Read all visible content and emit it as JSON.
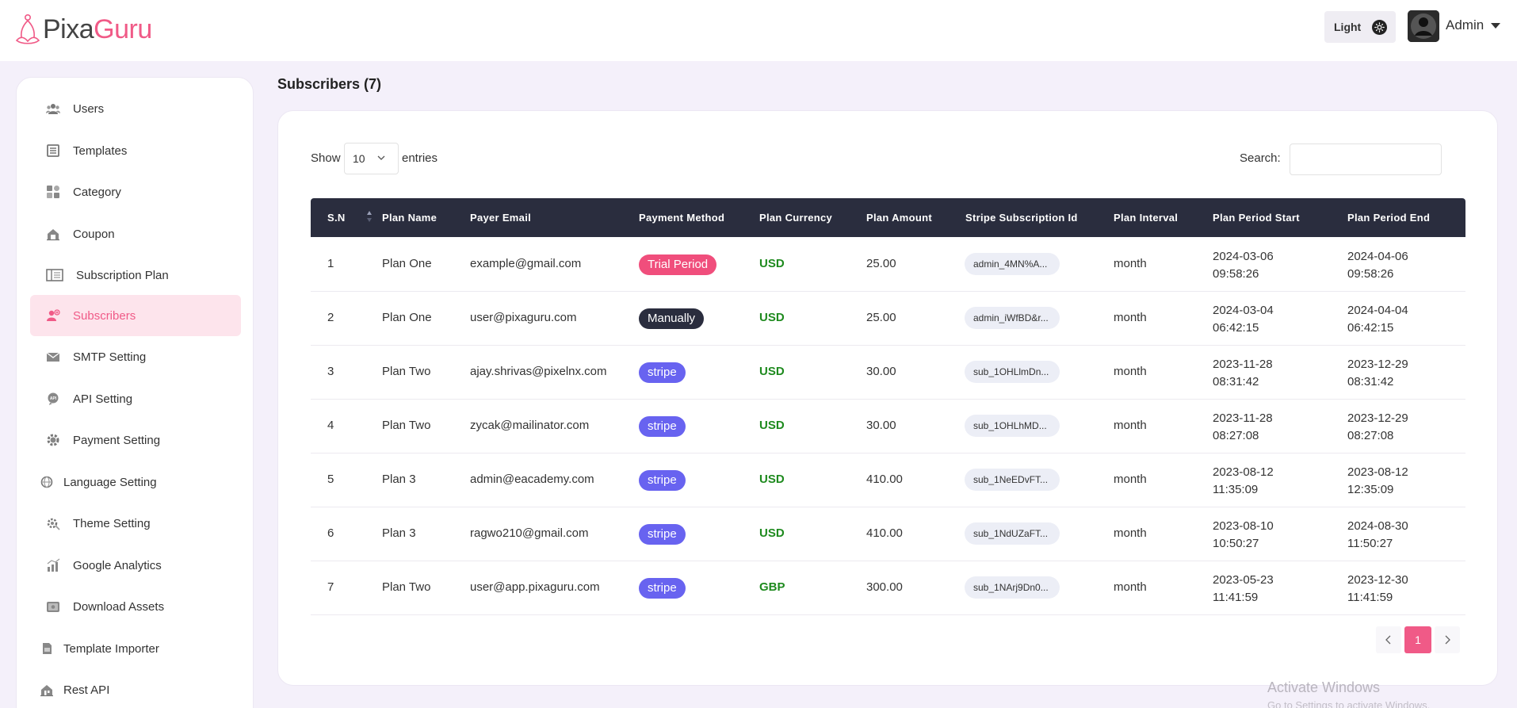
{
  "header": {
    "logo_part1": "Pixa",
    "logo_part2": "Guru",
    "theme_label": "Light",
    "user_name": "Admin"
  },
  "sidebar": {
    "items": [
      {
        "label": "Users",
        "icon": "users-icon"
      },
      {
        "label": "Templates",
        "icon": "templates-icon"
      },
      {
        "label": "Category",
        "icon": "category-icon"
      },
      {
        "label": "Coupon",
        "icon": "coupon-icon"
      },
      {
        "label": "Subscription Plan",
        "icon": "subscription-plan-icon"
      },
      {
        "label": "Subscribers",
        "icon": "subscribers-icon",
        "active": true
      },
      {
        "label": "SMTP Setting",
        "icon": "mail-icon"
      },
      {
        "label": "API Setting",
        "icon": "api-icon"
      },
      {
        "label": "Payment Setting",
        "icon": "payment-gear-icon"
      },
      {
        "label": "Language Setting",
        "icon": "language-icon"
      },
      {
        "label": "Theme Setting",
        "icon": "theme-icon"
      },
      {
        "label": "Google Analytics",
        "icon": "analytics-icon"
      },
      {
        "label": "Download Assets",
        "icon": "download-icon"
      },
      {
        "label": "Template Importer",
        "icon": "importer-icon"
      },
      {
        "label": "Rest API",
        "icon": "rest-api-icon"
      }
    ]
  },
  "main": {
    "title": "Subscribers (7)",
    "show_label": "Show",
    "entries_value": "10",
    "entries_label": "entries",
    "search_label": "Search:",
    "search_value": "",
    "columns": [
      "S.N",
      "Plan Name",
      "Payer Email",
      "Payment Method",
      "Plan Currency",
      "Plan Amount",
      "Stripe Subscription Id",
      "Plan Interval",
      "Plan Period Start",
      "Plan Period End"
    ],
    "rows": [
      {
        "sn": "1",
        "plan": "Plan One",
        "email": "example@gmail.com",
        "method": "Trial Period",
        "currency": "USD",
        "amount": "25.00",
        "sub_id": "admin_4MN%A...",
        "interval": "month",
        "start_date": "2024-03-06",
        "start_time": "09:58:26",
        "end_date": "2024-04-06",
        "end_time": "09:58:26"
      },
      {
        "sn": "2",
        "plan": "Plan One",
        "email": "user@pixaguru.com",
        "method": "Manually",
        "currency": "USD",
        "amount": "25.00",
        "sub_id": "admin_iWfBD&r...",
        "interval": "month",
        "start_date": "2024-03-04",
        "start_time": "06:42:15",
        "end_date": "2024-04-04",
        "end_time": "06:42:15"
      },
      {
        "sn": "3",
        "plan": "Plan Two",
        "email": "ajay.shrivas@pixelnx.com",
        "method": "stripe",
        "currency": "USD",
        "amount": "30.00",
        "sub_id": "sub_1OHLlmDn...",
        "interval": "month",
        "start_date": "2023-11-28",
        "start_time": "08:31:42",
        "end_date": "2023-12-29",
        "end_time": "08:31:42"
      },
      {
        "sn": "4",
        "plan": "Plan Two",
        "email": "zycak@mailinator.com",
        "method": "stripe",
        "currency": "USD",
        "amount": "30.00",
        "sub_id": "sub_1OHLhMD...",
        "interval": "month",
        "start_date": "2023-11-28",
        "start_time": "08:27:08",
        "end_date": "2023-12-29",
        "end_time": "08:27:08"
      },
      {
        "sn": "5",
        "plan": "Plan 3",
        "email": "admin@eacademy.com",
        "method": "stripe",
        "currency": "USD",
        "amount": "410.00",
        "sub_id": "sub_1NeEDvFT...",
        "interval": "month",
        "start_date": "2023-08-12",
        "start_time": "11:35:09",
        "end_date": "2023-08-12",
        "end_time": "12:35:09"
      },
      {
        "sn": "6",
        "plan": "Plan 3",
        "email": "ragwo210@gmail.com",
        "method": "stripe",
        "currency": "USD",
        "amount": "410.00",
        "sub_id": "sub_1NdUZaFT...",
        "interval": "month",
        "start_date": "2023-08-10",
        "start_time": "10:50:27",
        "end_date": "2024-08-30",
        "end_time": "11:50:27"
      },
      {
        "sn": "7",
        "plan": "Plan Two",
        "email": "user@app.pixaguru.com",
        "method": "stripe",
        "currency": "GBP",
        "amount": "300.00",
        "sub_id": "sub_1NArj9Dn0...",
        "interval": "month",
        "start_date": "2023-05-23",
        "start_time": "11:41:59",
        "end_date": "2023-12-30",
        "end_time": "11:41:59"
      }
    ],
    "pagination": {
      "current_page": "1"
    }
  },
  "watermark": {
    "line1": "Activate Windows",
    "line2": "Go to Settings to activate Windows."
  },
  "colors": {
    "brand": "#f05a87",
    "table_header": "#2a2d3e",
    "currency": "#1e8a1e",
    "badge_trial": "#f04e7c",
    "badge_manual": "#2a2d3e",
    "badge_stripe": "#6863f0"
  }
}
